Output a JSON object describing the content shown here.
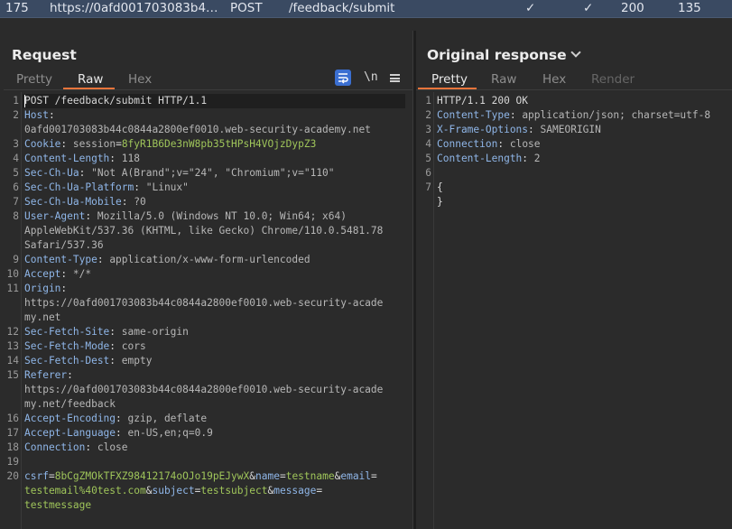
{
  "history_row": {
    "number": "175",
    "host": "https://0afd001703083b44c0844a2800ef0010.web-security-academy.net",
    "method": "POST",
    "url": "/feedback/submit",
    "check1": "✓",
    "check2": "✓",
    "status": "200",
    "length": "135"
  },
  "request_panel": {
    "title": "Request",
    "tabs": [
      "Pretty",
      "Raw",
      "Hex"
    ],
    "active_tab": "Raw",
    "toolbar": {
      "newline_label": "\\n"
    }
  },
  "response_panel": {
    "title": "Original response",
    "tabs": [
      "Pretty",
      "Raw",
      "Hex",
      "Render"
    ],
    "active_tab": "Pretty"
  },
  "request_lines": [
    {
      "n": "1",
      "parts": [
        [
          "p",
          "POST /feedback/submit HTTP/1.1"
        ]
      ]
    },
    {
      "n": "2",
      "parts": [
        [
          "k",
          "Host"
        ],
        [
          "p",
          ":"
        ]
      ]
    },
    {
      "n": "",
      "parts": [
        [
          "v",
          "0afd001703083b44c0844a2800ef0010.web-security-academy.net"
        ]
      ]
    },
    {
      "n": "3",
      "parts": [
        [
          "k",
          "Cookie"
        ],
        [
          "p",
          ": "
        ],
        [
          "v",
          "session"
        ],
        [
          "p",
          "="
        ],
        [
          "g",
          "8fyR1B6De3nW8pb35tHPsH4VOjzDypZ3"
        ]
      ]
    },
    {
      "n": "4",
      "parts": [
        [
          "k",
          "Content-Length"
        ],
        [
          "p",
          ": "
        ],
        [
          "v",
          "118"
        ]
      ]
    },
    {
      "n": "5",
      "parts": [
        [
          "k",
          "Sec-Ch-Ua"
        ],
        [
          "p",
          ": "
        ],
        [
          "v",
          "\"Not A(Brand\";v=\"24\", \"Chromium\";v=\"110\""
        ]
      ]
    },
    {
      "n": "6",
      "parts": [
        [
          "k",
          "Sec-Ch-Ua-Platform"
        ],
        [
          "p",
          ": "
        ],
        [
          "v",
          "\"Linux\""
        ]
      ]
    },
    {
      "n": "7",
      "parts": [
        [
          "k",
          "Sec-Ch-Ua-Mobile"
        ],
        [
          "p",
          ": "
        ],
        [
          "v",
          "?0"
        ]
      ]
    },
    {
      "n": "8",
      "parts": [
        [
          "k",
          "User-Agent"
        ],
        [
          "p",
          ": "
        ],
        [
          "v",
          "Mozilla/5.0 (Windows NT 10.0; Win64; x64)"
        ]
      ]
    },
    {
      "n": "",
      "parts": [
        [
          "v",
          "AppleWebKit/537.36 (KHTML, like Gecko) Chrome/110.0.5481.78"
        ]
      ]
    },
    {
      "n": "",
      "parts": [
        [
          "v",
          " Safari/537.36"
        ]
      ]
    },
    {
      "n": "9",
      "parts": [
        [
          "k",
          "Content-Type"
        ],
        [
          "p",
          ": "
        ],
        [
          "v",
          "application/x-www-form-urlencoded"
        ]
      ]
    },
    {
      "n": "10",
      "parts": [
        [
          "k",
          "Accept"
        ],
        [
          "p",
          ": "
        ],
        [
          "v",
          "*/*"
        ]
      ]
    },
    {
      "n": "11",
      "parts": [
        [
          "k",
          "Origin"
        ],
        [
          "p",
          ":"
        ]
      ]
    },
    {
      "n": "",
      "parts": [
        [
          "v",
          "https://0afd001703083b44c0844a2800ef0010.web-security-acade"
        ]
      ]
    },
    {
      "n": "",
      "parts": [
        [
          "v",
          "my.net"
        ]
      ]
    },
    {
      "n": "12",
      "parts": [
        [
          "k",
          "Sec-Fetch-Site"
        ],
        [
          "p",
          ": "
        ],
        [
          "v",
          "same-origin"
        ]
      ]
    },
    {
      "n": "13",
      "parts": [
        [
          "k",
          "Sec-Fetch-Mode"
        ],
        [
          "p",
          ": "
        ],
        [
          "v",
          "cors"
        ]
      ]
    },
    {
      "n": "14",
      "parts": [
        [
          "k",
          "Sec-Fetch-Dest"
        ],
        [
          "p",
          ": "
        ],
        [
          "v",
          "empty"
        ]
      ]
    },
    {
      "n": "15",
      "parts": [
        [
          "k",
          "Referer"
        ],
        [
          "p",
          ":"
        ]
      ]
    },
    {
      "n": "",
      "parts": [
        [
          "v",
          "https://0afd001703083b44c0844a2800ef0010.web-security-acade"
        ]
      ]
    },
    {
      "n": "",
      "parts": [
        [
          "v",
          "my.net/feedback"
        ]
      ]
    },
    {
      "n": "16",
      "parts": [
        [
          "k",
          "Accept-Encoding"
        ],
        [
          "p",
          ": "
        ],
        [
          "v",
          "gzip, deflate"
        ]
      ]
    },
    {
      "n": "17",
      "parts": [
        [
          "k",
          "Accept-Language"
        ],
        [
          "p",
          ": "
        ],
        [
          "v",
          "en-US,en;q=0.9"
        ]
      ]
    },
    {
      "n": "18",
      "parts": [
        [
          "k",
          "Connection"
        ],
        [
          "p",
          ": "
        ],
        [
          "v",
          "close"
        ]
      ]
    },
    {
      "n": "19",
      "parts": []
    },
    {
      "n": "20",
      "parts": [
        [
          "k",
          "csrf"
        ],
        [
          "p",
          "="
        ],
        [
          "g",
          "8bCgZMOkTFXZ98412174oOJo19pEJywX"
        ],
        [
          "p",
          "&"
        ],
        [
          "k",
          "name"
        ],
        [
          "p",
          "="
        ],
        [
          "g",
          "testname"
        ],
        [
          "p",
          "&"
        ],
        [
          "k",
          "email"
        ],
        [
          "p",
          "="
        ]
      ]
    },
    {
      "n": "",
      "parts": [
        [
          "g",
          "testemail%40test.com"
        ],
        [
          "p",
          "&"
        ],
        [
          "k",
          "subject"
        ],
        [
          "p",
          "="
        ],
        [
          "g",
          "testsubject"
        ],
        [
          "p",
          "&"
        ],
        [
          "k",
          "message"
        ],
        [
          "p",
          "="
        ]
      ]
    },
    {
      "n": "",
      "parts": [
        [
          "g",
          "testmessage"
        ]
      ]
    }
  ],
  "response_lines": [
    {
      "n": "1",
      "parts": [
        [
          "p",
          "HTTP/1.1 200 OK"
        ]
      ]
    },
    {
      "n": "2",
      "parts": [
        [
          "k",
          "Content-Type"
        ],
        [
          "p",
          ": "
        ],
        [
          "v",
          "application/json; charset=utf-8"
        ]
      ]
    },
    {
      "n": "3",
      "parts": [
        [
          "k",
          "X-Frame-Options"
        ],
        [
          "p",
          ": "
        ],
        [
          "v",
          "SAMEORIGIN"
        ]
      ]
    },
    {
      "n": "4",
      "parts": [
        [
          "k",
          "Connection"
        ],
        [
          "p",
          ": "
        ],
        [
          "v",
          "close"
        ]
      ]
    },
    {
      "n": "5",
      "parts": [
        [
          "k",
          "Content-Length"
        ],
        [
          "p",
          ": "
        ],
        [
          "v",
          "2"
        ]
      ]
    },
    {
      "n": "6",
      "parts": []
    },
    {
      "n": "7",
      "parts": [
        [
          "p",
          "{"
        ]
      ]
    },
    {
      "n": "",
      "parts": [
        [
          "p",
          "}"
        ]
      ]
    }
  ]
}
